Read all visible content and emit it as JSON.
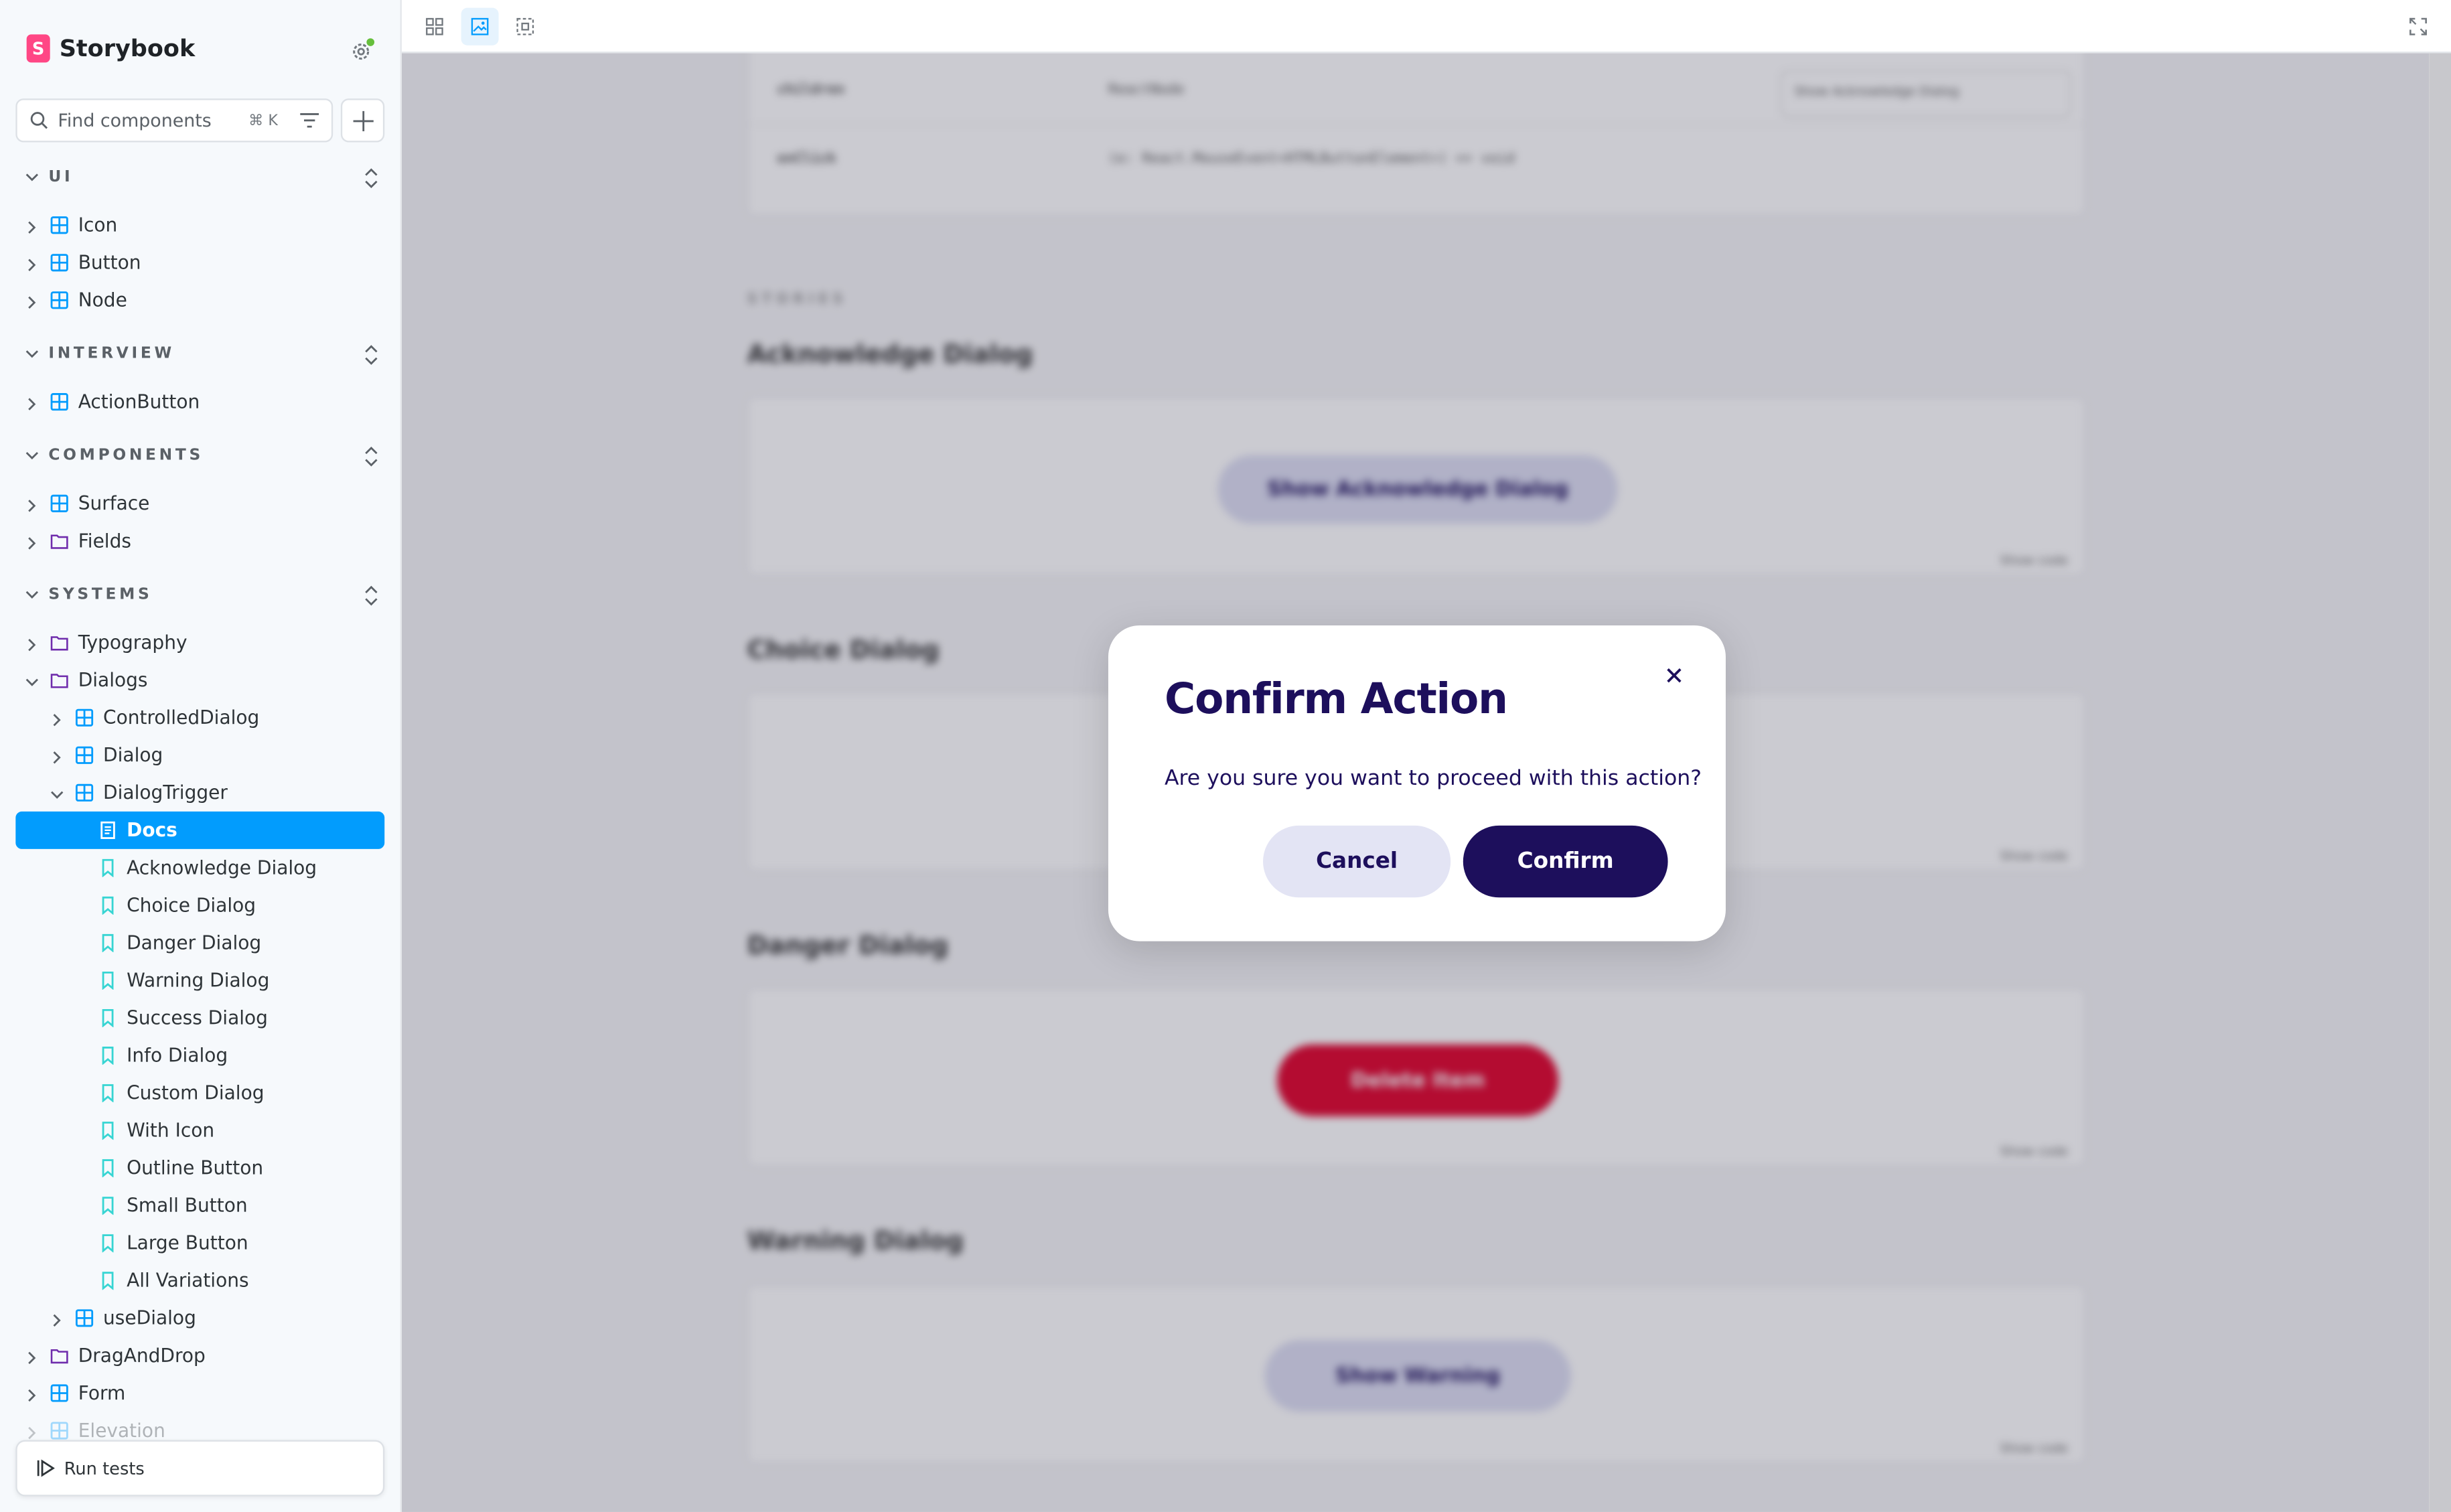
{
  "brand": {
    "name": "Storybook",
    "logo_letter": "S",
    "accent": "#ff4785"
  },
  "search": {
    "placeholder": "Find components",
    "shortcut": "⌘ K"
  },
  "sections": [
    {
      "label": "UI",
      "items": [
        "Icon",
        "Button",
        "Node"
      ]
    },
    {
      "label": "INTERVIEW",
      "items": [
        "ActionButton"
      ]
    },
    {
      "label": "COMPONENTS",
      "items": [
        "Surface",
        "Fields"
      ]
    },
    {
      "label": "SYSTEMS",
      "items": [
        "Typography",
        "Dialogs",
        "ControlledDialog",
        "Dialog",
        "DialogTrigger",
        "Docs",
        "Acknowledge Dialog",
        "Choice Dialog",
        "Danger Dialog",
        "Warning Dialog",
        "Success Dialog",
        "Info Dialog",
        "Custom Dialog",
        "With Icon",
        "Outline Button",
        "Small Button",
        "Large Button",
        "All Variations",
        "useDialog",
        "DragAndDrop",
        "Form",
        "Elevation"
      ]
    }
  ],
  "run_tests": "Run tests",
  "background": {
    "rows": [
      {
        "name": "children",
        "value": "ReactNode",
        "default": "Show Acknowledge Dialog"
      },
      {
        "name": "onClick",
        "value": "(e: React.MouseEvent<HTMLButtonElement>) => void"
      }
    ],
    "stories_label": "STORIES",
    "stories": [
      {
        "title": "Acknowledge Dialog",
        "button": "Show Acknowledge Dialog"
      },
      {
        "title": "Choice Dialog",
        "button": ""
      },
      {
        "title": "Danger Dialog",
        "button": "Delete Item"
      },
      {
        "title": "Warning Dialog",
        "button": "Show Warning"
      }
    ],
    "show_code": "Show code"
  },
  "dialog": {
    "title": "Confirm Action",
    "message": "Are you sure you want to proceed with this action?",
    "cancel": "Cancel",
    "confirm": "Confirm"
  },
  "colors": {
    "selected": "#029cfd",
    "dialog_primary": "#1d0f5c",
    "danger": "#e0002a"
  }
}
